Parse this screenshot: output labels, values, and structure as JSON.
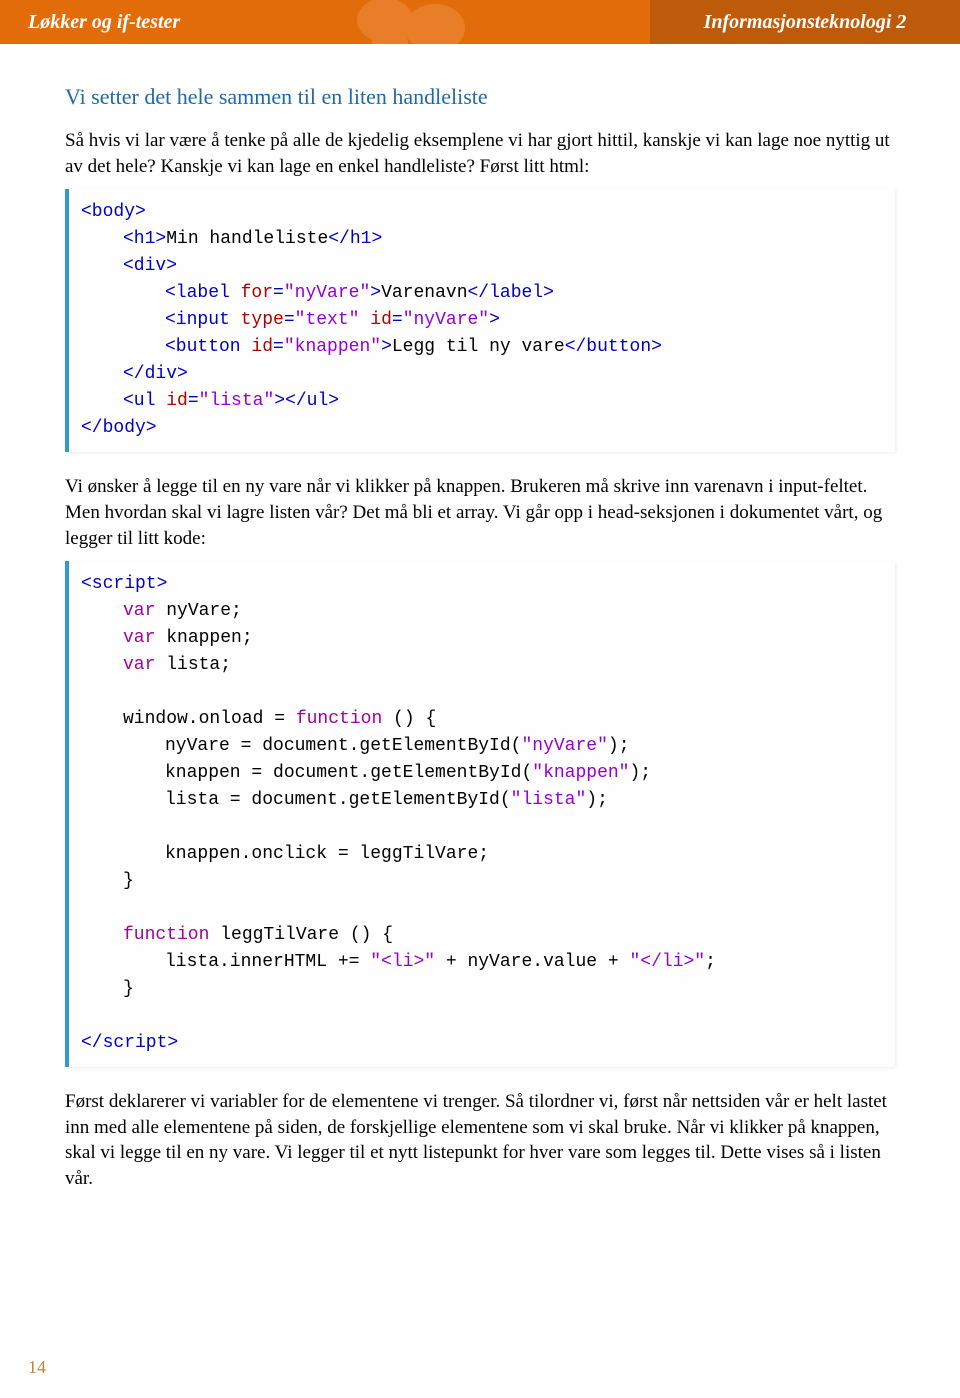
{
  "header": {
    "left": "Løkker og if-tester",
    "right": "Informasjonsteknologi 2"
  },
  "sectionTitle": "Vi setter det hele sammen til en liten handleliste",
  "para1": "Så hvis vi lar være å tenke på alle de kjedelig eksemplene vi har gjort hittil, kanskje vi kan lage noe nyttig ut av det hele? Kanskje vi kan lage en enkel handleliste? Først litt html:",
  "code1": {
    "l1": {
      "a": "<body>"
    },
    "l2": {
      "a": "<h1>",
      "b": "Min handleliste",
      "c": "</h1>"
    },
    "l3": {
      "a": "<div>"
    },
    "l4": {
      "a": "<label ",
      "b": "for",
      "c": "=",
      "d": "\"nyVare\"",
      "e": ">",
      "f": "Varenavn",
      "g": "</label>"
    },
    "l5": {
      "a": "<input ",
      "b": "type",
      "c": "=",
      "d": "\"text\"",
      "e": " id",
      "f": "=",
      "g": "\"nyVare\"",
      "h": ">"
    },
    "l6": {
      "a": "<button ",
      "b": "id",
      "c": "=",
      "d": "\"knappen\"",
      "e": ">",
      "f": "Legg til ny vare",
      "g": "</button>"
    },
    "l7": {
      "a": "</div>"
    },
    "l8": {
      "a": "<ul ",
      "b": "id",
      "c": "=",
      "d": "\"lista\"",
      "e": "></ul>"
    },
    "l9": {
      "a": "</body>"
    }
  },
  "para2": "Vi ønsker å legge til en ny vare når vi klikker på knappen. Brukeren må skrive inn varenavn i input-feltet. Men hvordan skal vi lagre listen vår? Det må bli et array. Vi går opp i head-seksjonen i dokumentet vårt, og legger til litt kode:",
  "code2": {
    "l1": {
      "a": "<script>"
    },
    "l2": {
      "a": "var ",
      "b": "nyVare;"
    },
    "l3": {
      "a": "var ",
      "b": "knappen;"
    },
    "l4": {
      "a": "var ",
      "b": "lista;"
    },
    "blank1": " ",
    "l5": {
      "a": "window.onload = ",
      "b": "function ",
      "c": "() {"
    },
    "l6": {
      "a": "nyVare = document.getElementById(",
      "b": "\"nyVare\"",
      "c": ");"
    },
    "l7": {
      "a": "knappen = document.getElementById(",
      "b": "\"knappen\"",
      "c": ");"
    },
    "l8": {
      "a": "lista = document.getElementById(",
      "b": "\"lista\"",
      "c": ");"
    },
    "blank2": " ",
    "l9": {
      "a": "knappen.onclick = leggTilVare;"
    },
    "l10": {
      "a": "}"
    },
    "blank3": " ",
    "l11": {
      "a": "function ",
      "b": "leggTilVare () {"
    },
    "l12": {
      "a": "lista.innerHTML += ",
      "b": "\"<li>\"",
      "c": " + nyVare.value + ",
      "d": "\"</li>\"",
      "e": ";"
    },
    "l13": {
      "a": "}"
    },
    "blank4": " ",
    "l14": {
      "a": "</script>"
    }
  },
  "para3": "Først deklarerer vi variabler for de elementene vi trenger. Så tilordner vi, først når nettsiden vår er helt lastet inn med alle elementene på siden, de forskjellige elementene som vi skal bruke. Når vi klikker på knappen, skal vi legge til en ny vare. Vi legger til et nytt listepunkt for hver vare som legges til. Dette vises så i listen vår.",
  "pageNumber": "14"
}
